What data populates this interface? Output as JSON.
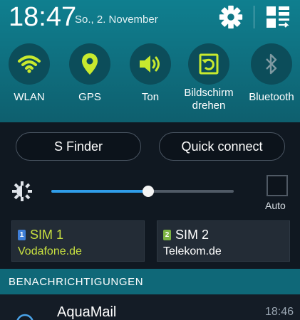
{
  "status": {
    "time": "18:47",
    "date": "So., 2. November"
  },
  "tiles": [
    {
      "label": "WLAN",
      "icon": "wifi-icon",
      "active": true
    },
    {
      "label": "GPS",
      "icon": "location-pin-icon",
      "active": true
    },
    {
      "label": "Ton",
      "icon": "speaker-icon",
      "active": true
    },
    {
      "label": "Bildschirm drehen",
      "icon": "screen-rotate-icon",
      "active": true
    },
    {
      "label": "Bluetooth",
      "icon": "bluetooth-icon",
      "active": false
    }
  ],
  "actions": {
    "s_finder": "S Finder",
    "quick_connect": "Quick connect"
  },
  "brightness": {
    "level": 0.53,
    "auto_label": "Auto",
    "auto_checked": false
  },
  "sims": [
    {
      "label": "SIM 1",
      "number": "1",
      "network": "Vodafone.de",
      "color": "#c8e040",
      "icon_bg": "#3f7fd8"
    },
    {
      "label": "SIM 2",
      "number": "2",
      "network": "Telekom.de",
      "color": "#ffffff",
      "icon_bg": "#7cb342"
    }
  ],
  "notifications": {
    "header": "BENACHRICHTIGUNGEN",
    "items": [
      {
        "app": "AquaMail",
        "time": "18:46"
      }
    ]
  },
  "colors": {
    "active_icon": "#c8ea2e",
    "inactive_icon": "#7e99a1",
    "accent": "#2f9de9"
  }
}
